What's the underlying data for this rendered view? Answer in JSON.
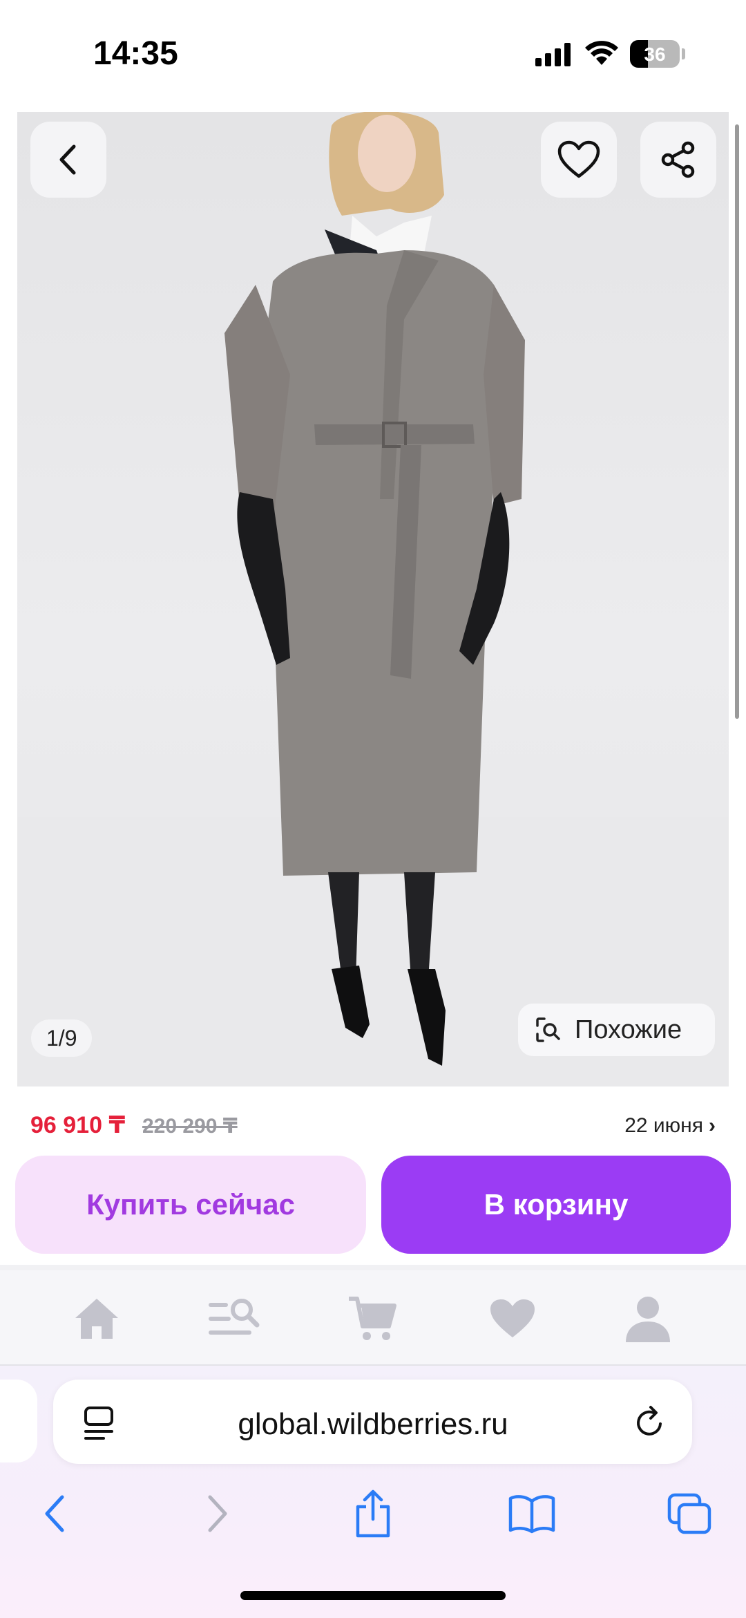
{
  "status_bar": {
    "time": "14:35",
    "battery": "36",
    "battery_level": 0.36
  },
  "product": {
    "image_counter": "1/9",
    "similar_label": "Похожие",
    "price": "96 910 ₸",
    "old_price": "220 290 ₸",
    "delivery_date": "22 июня",
    "delivery_chevron": "›"
  },
  "actions": {
    "buy_now": "Купить сейчас",
    "add_to_cart": "В корзину"
  },
  "tabbar": {
    "items": [
      {
        "icon": "home-icon"
      },
      {
        "icon": "catalog-search-icon"
      },
      {
        "icon": "cart-icon"
      },
      {
        "icon": "heart-icon"
      },
      {
        "icon": "profile-icon"
      }
    ]
  },
  "browser": {
    "url": "global.wildberries.ru"
  },
  "colors": {
    "accent": "#9b3cf4",
    "accent_light": "#f7e1fb",
    "price_red": "#e5203a",
    "ios_blue": "#2b7cf6",
    "tab_icon": "#c3c3cc"
  }
}
